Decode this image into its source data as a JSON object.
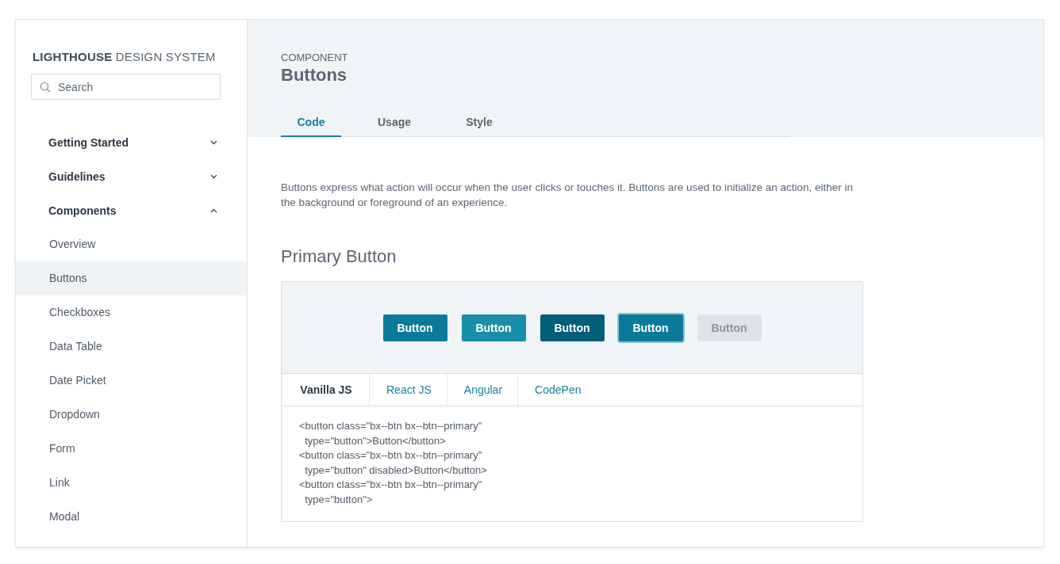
{
  "brand": "**LIGHTHOUSE** DESIGN SYSTEM",
  "search": {
    "placeholder": "Search"
  },
  "nav": [
    {
      "label": "Getting Started",
      "expanded": false
    },
    {
      "label": "Guidelines",
      "expanded": false
    },
    {
      "label": "Components",
      "expanded": true,
      "children": [
        {
          "label": "Overview",
          "selected": false
        },
        {
          "label": "Buttons",
          "selected": true
        },
        {
          "label": "Checkboxes",
          "selected": false
        },
        {
          "label": "Data Table",
          "selected": false
        },
        {
          "label": "Date Picket",
          "selected": false
        },
        {
          "label": "Dropdown",
          "selected": false
        },
        {
          "label": "Form",
          "selected": false
        },
        {
          "label": "Link",
          "selected": false
        },
        {
          "label": "Modal",
          "selected": false
        }
      ]
    }
  ],
  "header": {
    "eyebrow": "COMPONENT",
    "title": "Buttons"
  },
  "tabs": [
    {
      "label": "Code",
      "selected": true
    },
    {
      "label": "Usage",
      "selected": false
    },
    {
      "label": "Style",
      "selected": false
    }
  ],
  "description": "Buttons express what action will occur when the user clicks or touches it. Buttons are used to initialize an action, either in the background or foreground of an experience.",
  "section_title": "Primary Button",
  "demo_buttons": [
    {
      "label": "Button",
      "kind": "default"
    },
    {
      "label": "Button",
      "kind": "hover"
    },
    {
      "label": "Button",
      "kind": "active"
    },
    {
      "label": "Button",
      "kind": "focus"
    },
    {
      "label": "Button",
      "kind": "disabled"
    }
  ],
  "code_tabs": [
    {
      "label": "Vanilla JS",
      "selected": true
    },
    {
      "label": "React JS",
      "selected": false
    },
    {
      "label": "Angular",
      "selected": false
    },
    {
      "label": "CodePen",
      "selected": false
    }
  ],
  "code": "<button class=\"bx--btn bx--btn--primary\"\n  type=\"button\">Button</button>\n<button class=\"bx--btn bx--btn--primary\"\n  type=\"button\" disabled>Button</button>\n<button class=\"bx--btn bx--btn--primary\"\n  type=\"button\">"
}
